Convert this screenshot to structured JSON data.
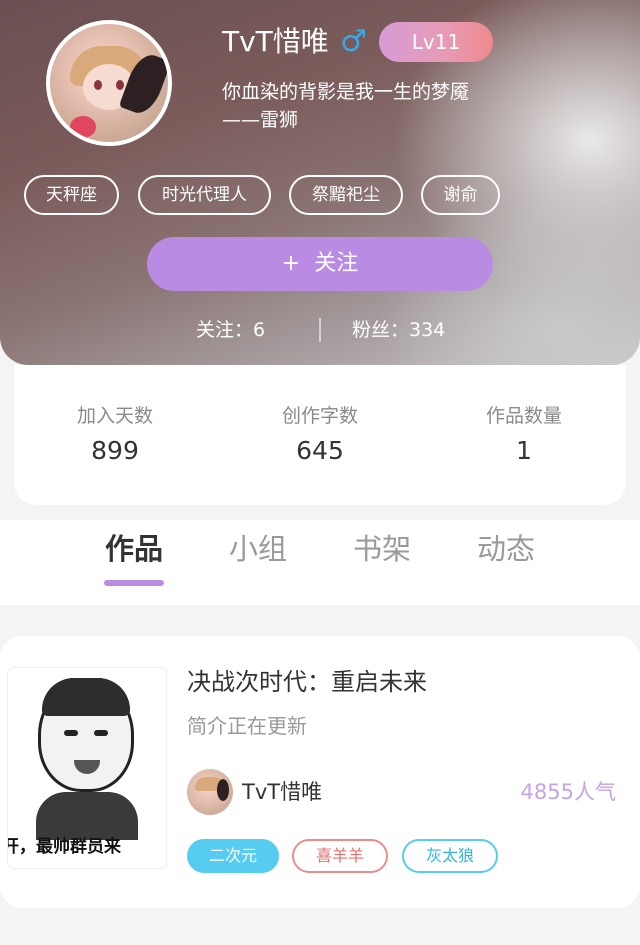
{
  "profile": {
    "username": "TvT惜唯",
    "gender_icon": "male-symbol-icon",
    "gender_symbol": "♂",
    "level": "Lv11",
    "bio_line1": "你血染的背影是我一生的梦魇",
    "bio_line2": "——雷狮",
    "tags": [
      "天秤座",
      "时光代理人",
      "祭黯祀尘",
      "谢俞"
    ],
    "follow_button": {
      "icon": "+",
      "label": "关注"
    },
    "following_label": "关注：6",
    "fans_label": "粉丝：334"
  },
  "stats": [
    {
      "label": "加入天数",
      "value": "899"
    },
    {
      "label": "创作字数",
      "value": "645"
    },
    {
      "label": "作品数量",
      "value": "1"
    }
  ],
  "tabs": [
    {
      "label": "作品",
      "active": true
    },
    {
      "label": "小组",
      "active": false
    },
    {
      "label": "书架",
      "active": false
    },
    {
      "label": "动态",
      "active": false
    }
  ],
  "works": [
    {
      "title": "决战次时代：重启未来",
      "description": "简介正在更新",
      "cover_caption": "开，最帅群员来",
      "author": "TvT惜唯",
      "popularity": "4855人气",
      "tags": [
        "二次元",
        "喜羊羊",
        "灰太狼"
      ]
    }
  ],
  "colors": {
    "accent_purple": "#b98be2",
    "tag_blue": "#56cdf0",
    "tag_red": "#ec8d8d",
    "popularity": "#c4a3e6"
  }
}
